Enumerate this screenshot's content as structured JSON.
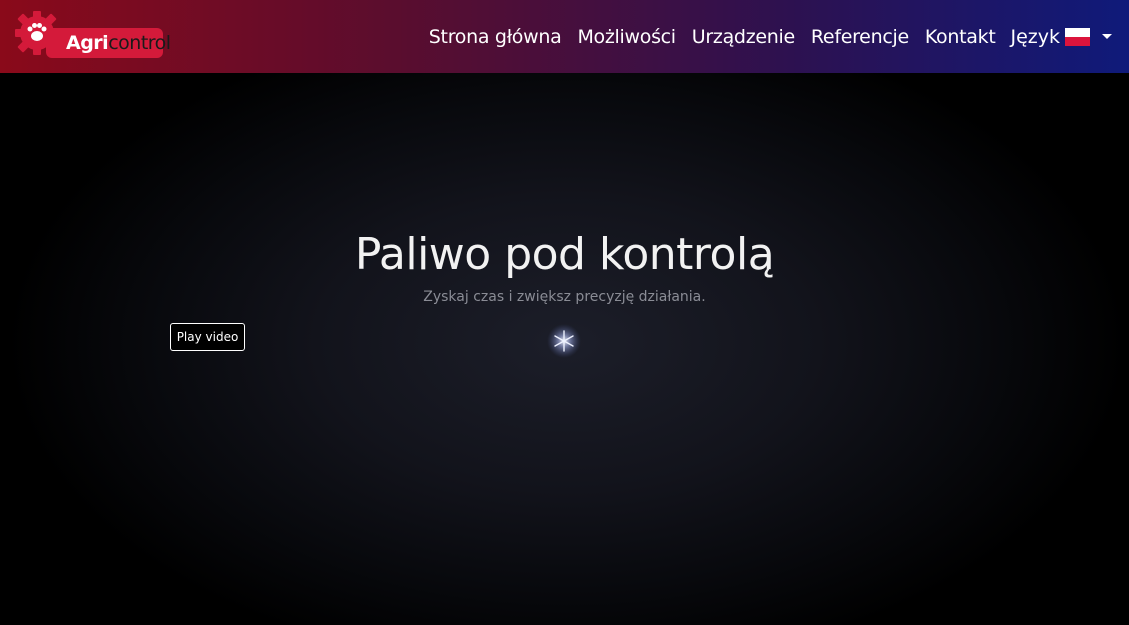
{
  "logo": {
    "agri": "Agri",
    "control": "control",
    "icon": "gear-paw-icon",
    "brand_color": "#d41a3a"
  },
  "nav": {
    "items": [
      {
        "label": "Strona główna"
      },
      {
        "label": "Możliwości"
      },
      {
        "label": "Urządzenie"
      },
      {
        "label": "Referencje"
      },
      {
        "label": "Kontakt"
      }
    ],
    "language_label": "Język",
    "language_flag": "poland-flag-icon"
  },
  "hero": {
    "title": "Paliwo pod kontrolą",
    "subtitle": "Zyskaj czas i zwiększ precyzję działania.",
    "play_button": "Play video",
    "spark_icon": "sparkle-icon"
  }
}
